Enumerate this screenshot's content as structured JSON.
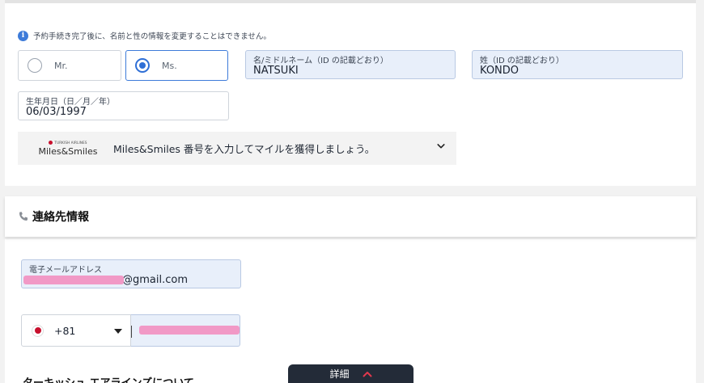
{
  "passenger": {
    "notice": "予約手続き完了後に、名前と性の情報を変更することはできません。",
    "title_options": [
      {
        "label": "Mr.",
        "selected": false
      },
      {
        "label": "Ms.",
        "selected": true
      }
    ],
    "first_name": {
      "label": "名/ミドルネーム（ID の記載どおり）",
      "value": "NATSUKI"
    },
    "last_name": {
      "label": "姓（ID の記載どおり）",
      "value": "KONDO"
    },
    "birthdate": {
      "label": "生年月日（日／月／年）",
      "value": "06/03/1997"
    },
    "miles": {
      "logo_small": "TURKISH AIRLINES",
      "logo_text": "Miles&Smiles",
      "text": "Miles&Smiles 番号を入力してマイルを獲得しましょう。",
      "expanded": false
    }
  },
  "contact": {
    "icon": "phone-icon",
    "title": "連絡先情報",
    "email": {
      "label": "電子メールアドレス",
      "value_visible": "@gmail.com"
    },
    "phone": {
      "country_code": "+81",
      "flag": "japan-flag"
    }
  },
  "next_section_text": "ターキッシュ エアラインズについて",
  "footer": {
    "detail_label": "詳細"
  },
  "colors": {
    "accent": "#2f6fd6",
    "brand_red": "#c8102e",
    "redaction": "#f199c6",
    "dark_tab": "#232b38"
  }
}
